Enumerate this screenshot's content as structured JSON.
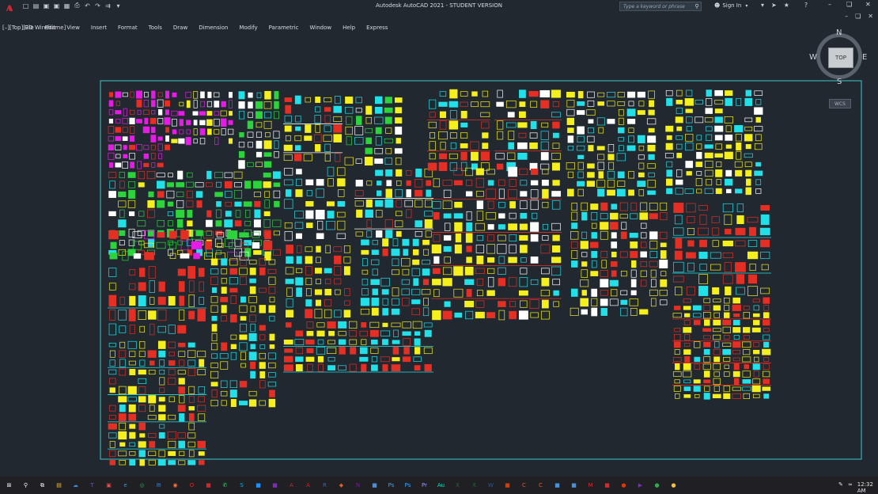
{
  "window": {
    "title": "Autodesk AutoCAD 2021 - STUDENT VERSION"
  },
  "app_logo": "A",
  "quick_access": [
    "new-icon",
    "open-icon",
    "save-icon",
    "saveas-icon",
    "webmobile-icon",
    "plot-icon",
    "undo-icon",
    "redo-icon",
    "share-icon",
    "dropdown-icon"
  ],
  "search": {
    "placeholder": "Type a keyword or phrase"
  },
  "account": {
    "sign_in": "Sign In"
  },
  "top_icons": [
    "cart-icon",
    "exchange-icon",
    "star-icon",
    "help-icon"
  ],
  "menu": [
    "File",
    "Edit",
    "View",
    "Insert",
    "Format",
    "Tools",
    "Draw",
    "Dimension",
    "Modify",
    "Parametric",
    "Window",
    "Help",
    "Express"
  ],
  "viewport": {
    "label": "[–][Top][2D Wireframe]"
  },
  "viewcube": {
    "face": "TOP",
    "north": "N",
    "south": "S",
    "east": "E",
    "west": "W",
    "wcs": "WCS"
  },
  "taskbar": {
    "apps": [
      {
        "name": "windows-start-icon",
        "color": "#ffffff",
        "glyph": "⊞"
      },
      {
        "name": "search-icon",
        "color": "#ffffff",
        "glyph": "⚲"
      },
      {
        "name": "task-view-icon",
        "color": "#ffffff",
        "glyph": "⧉"
      },
      {
        "name": "file-explorer-icon",
        "color": "#f3c13a",
        "glyph": "▤"
      },
      {
        "name": "onedrive-icon",
        "color": "#3b8fe0",
        "glyph": "☁"
      },
      {
        "name": "teams-icon",
        "color": "#6264a7",
        "glyph": "T"
      },
      {
        "name": "app-icon",
        "color": "#e14e4e",
        "glyph": "▣"
      },
      {
        "name": "edge-icon",
        "color": "#1fa7e0",
        "glyph": "e"
      },
      {
        "name": "chrome-icon",
        "color": "#34a853",
        "glyph": "◎"
      },
      {
        "name": "mail-icon",
        "color": "#3b8fe0",
        "glyph": "✉"
      },
      {
        "name": "firefox-icon",
        "color": "#ff7139",
        "glyph": "◉"
      },
      {
        "name": "opera-icon",
        "color": "#e0262d",
        "glyph": "O"
      },
      {
        "name": "cad-app-icon",
        "color": "#d0262d",
        "glyph": "■"
      },
      {
        "name": "whatsapp-icon",
        "color": "#25d366",
        "glyph": "✆"
      },
      {
        "name": "skype-icon",
        "color": "#00aff0",
        "glyph": "S"
      },
      {
        "name": "app-icon",
        "color": "#1e90ff",
        "glyph": "■"
      },
      {
        "name": "app-icon",
        "color": "#7b2cbf",
        "glyph": "■"
      },
      {
        "name": "autocad-icon",
        "color": "#d0262d",
        "glyph": "A"
      },
      {
        "name": "autocad-lt-icon",
        "color": "#d0262d",
        "glyph": "A"
      },
      {
        "name": "revit-icon",
        "color": "#2f6fb8",
        "glyph": "R"
      },
      {
        "name": "sketchup-icon",
        "color": "#e05a2b",
        "glyph": "◆"
      },
      {
        "name": "onenote-icon",
        "color": "#7719aa",
        "glyph": "N"
      },
      {
        "name": "app-icon",
        "color": "#4a90d9",
        "glyph": "■"
      },
      {
        "name": "photoshop-icon",
        "color": "#31a8ff",
        "glyph": "Ps"
      },
      {
        "name": "photoshop-icon",
        "color": "#31a8ff",
        "glyph": "Ps"
      },
      {
        "name": "premiere-icon",
        "color": "#9999ff",
        "glyph": "Pr"
      },
      {
        "name": "audition-icon",
        "color": "#00e4bb",
        "glyph": "Au"
      },
      {
        "name": "excel-icon",
        "color": "#1d6f42",
        "glyph": "X"
      },
      {
        "name": "excel-icon",
        "color": "#1d6f42",
        "glyph": "X"
      },
      {
        "name": "word-icon",
        "color": "#2b579a",
        "glyph": "W"
      },
      {
        "name": "app-icon",
        "color": "#d83b01",
        "glyph": "■"
      },
      {
        "name": "app-icon",
        "color": "#e05a2b",
        "glyph": "C"
      },
      {
        "name": "app-icon",
        "color": "#e05a2b",
        "glyph": "C"
      },
      {
        "name": "app-icon",
        "color": "#4a90d9",
        "glyph": "■"
      },
      {
        "name": "app-icon",
        "color": "#4a90d9",
        "glyph": "■"
      },
      {
        "name": "app-icon",
        "color": "#e0262d",
        "glyph": "M"
      },
      {
        "name": "app-icon",
        "color": "#e0262d",
        "glyph": "■"
      },
      {
        "name": "app-icon",
        "color": "#d83b01",
        "glyph": "●"
      },
      {
        "name": "media-player-icon",
        "color": "#7b2cbf",
        "glyph": "▶"
      },
      {
        "name": "app-icon",
        "color": "#34a853",
        "glyph": "●"
      },
      {
        "name": "app-icon",
        "color": "#f3c13a",
        "glyph": "●"
      }
    ],
    "time": "12:32 AM"
  },
  "colors": {
    "background": "#212830",
    "frame": "#3ec7cc",
    "yellow": "#f5ef1d",
    "red": "#e52e24",
    "magenta": "#e61ce6",
    "cyan": "#22e0e8",
    "green": "#2cd43c",
    "white": "#ffffff"
  }
}
